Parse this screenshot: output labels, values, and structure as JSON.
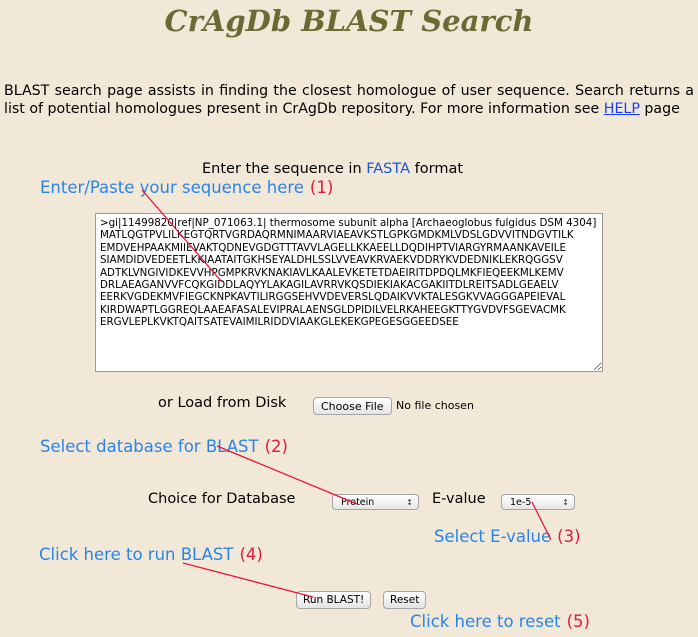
{
  "header": {
    "title": "CrAgDb BLAST Search"
  },
  "intro": {
    "text_before_link": "BLAST search page assists in finding the closest homologue of user sequence. Search returns a list of potential homologues present in CrAgDb repository. For more information see ",
    "link_label": "HELP",
    "text_after_link": " page"
  },
  "sequence_section": {
    "prompt_prefix": "Enter the sequence in ",
    "prompt_format": "FASTA",
    "prompt_suffix": " format",
    "textarea_value": ">gi|11499820|ref|NP_071063.1| thermosome subunit alpha [Archaeoglobus fulgidus DSM 4304]\nMATLQGTPVLILKEGTQRTVGRDAQRMNIMAARVIAEAVKSTLGPKGMDKMLVDSLGDVVITNDGVTILK\nEMDVEHPAAKMIIEVAKTQDNEVGDGTTTAVVLAGELLKKAEELLDQDIHPTVIARGYRMAANKAVEILE\nSIAMDIDVEDEETLKKIAATAITGKHSEYALDHLSSLVVEAVKRVAEKVDDRYKVDEDNIKLEKRQGGSV\nADTKLVNGIVIDKEVVHPGMPKRVKNAKIAVLKAALEVKETETDAEIRITDPDQLMKFIEQEEKMLKEMV\nDRLAEAGANVVFCQKGIDDLAQYYLAKAGILAVRRVKQSDIEKIAKACGAKIITDLREITSADLGEAELV\nEERKVGDEKMVFIEGCKNPKAVTILIRGGSEHVVDEVERSLQDAIKVVKTALESGKVVAGGGAPEIEVAL\nKIRDWAPTLGGREQLAAEAFASALEVIPRALAENSGLDPIDILVELRKAHEEGKTTYGVDVFSGEVACMK\nERGVLEPLKVKTQAITSATEVAIMILRIDDVIAAKGLEKEKGPEGESGGEEDSEE",
    "load_label": "or Load from Disk",
    "choose_file_label": "Choose File",
    "file_status": "No file chosen"
  },
  "options": {
    "database_label": "Choice for Database",
    "database_selected": "Protein",
    "evalue_label": "E-value",
    "evalue_selected": "1e-5",
    "select_arrows_glyph": "↕"
  },
  "actions": {
    "run_label": "Run BLAST!",
    "reset_label": "Reset"
  },
  "annotations": [
    {
      "text": "Enter/Paste your sequence here",
      "num": "(1)"
    },
    {
      "text": "Select database for BLAST",
      "num": "(2)"
    },
    {
      "text": "Select E-value",
      "num": "(3)"
    },
    {
      "text": "Click here to run BLAST",
      "num": "(4)"
    },
    {
      "text": "Click here to reset",
      "num": "(5)"
    }
  ],
  "colors": {
    "background": "#f1e8d8",
    "title": "#6b6a33",
    "annotation_text": "#2a84e8",
    "annotation_number": "#e8183a",
    "link": "#1a3cff"
  }
}
